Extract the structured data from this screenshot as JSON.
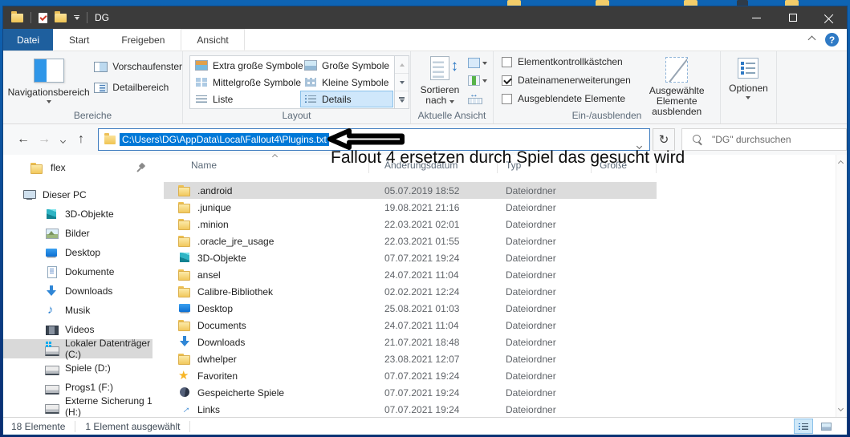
{
  "titlebar": {
    "title": "DG"
  },
  "tabs": {
    "file_label": "Datei",
    "items": [
      {
        "label": "Start",
        "active": false
      },
      {
        "label": "Freigeben",
        "active": false
      },
      {
        "label": "Ansicht",
        "active": true
      }
    ]
  },
  "ribbon": {
    "panes": {
      "label": "Bereiche",
      "nav_button": "Navigationsbereich",
      "preview_button": "Vorschaufenster",
      "details_button": "Detailbereich"
    },
    "layout": {
      "label": "Layout",
      "items": [
        {
          "label": "Extra große Symbole",
          "icon": "extra-large-icons-icon",
          "selected": false
        },
        {
          "label": "Große Symbole",
          "icon": "large-icons-icon",
          "selected": false
        },
        {
          "label": "Mittelgroße Symbole",
          "icon": "medium-icons-icon",
          "selected": false
        },
        {
          "label": "Kleine Symbole",
          "icon": "small-icons-icon",
          "selected": false
        },
        {
          "label": "Liste",
          "icon": "list-view-icon",
          "selected": false
        },
        {
          "label": "Details",
          "icon": "details-view-icon",
          "selected": true
        }
      ]
    },
    "current_view": {
      "label": "Aktuelle Ansicht",
      "sort_line1": "Sortieren",
      "sort_line2": "nach"
    },
    "show_hide": {
      "label": "Ein-/ausblenden",
      "checkboxes": [
        {
          "label": "Elementkontrollkästchen",
          "checked": false
        },
        {
          "label": "Dateinamenerweiterungen",
          "checked": true
        },
        {
          "label": "Ausgeblendete Elemente",
          "checked": false
        }
      ],
      "hide_selected_line1": "Ausgewählte",
      "hide_selected_line2": "Elemente ausblenden"
    },
    "options": {
      "button": "Optionen"
    }
  },
  "addressbar": {
    "path": "C:\\Users\\DG\\AppData\\Local\\Fallout4\\Plugins.txt",
    "search_placeholder": "\"DG\" durchsuchen"
  },
  "annotation": {
    "text": "Fallout 4 ersetzen durch Spiel das gesucht wird"
  },
  "sidebar": {
    "items": [
      {
        "label": "flex",
        "icon": "folder-icon",
        "quick": true,
        "pinned": true
      },
      {
        "label": "Dieser PC",
        "icon": "this-pc-icon",
        "root": true
      },
      {
        "label": "3D-Objekte",
        "icon": "cube-icon",
        "child": true
      },
      {
        "label": "Bilder",
        "icon": "pictures-icon",
        "child": true
      },
      {
        "label": "Desktop",
        "icon": "desktop-icon",
        "child": true
      },
      {
        "label": "Dokumente",
        "icon": "documents-icon",
        "child": true
      },
      {
        "label": "Downloads",
        "icon": "download-icon",
        "child": true
      },
      {
        "label": "Musik",
        "icon": "music-icon",
        "child": true
      },
      {
        "label": "Videos",
        "icon": "videos-icon",
        "child": true
      },
      {
        "label": "Lokaler Datenträger (C:)",
        "icon": "drive-windows-icon",
        "child": true,
        "selected": true
      },
      {
        "label": "Spiele (D:)",
        "icon": "drive-icon",
        "child": true
      },
      {
        "label": "Progs1 (F:)",
        "icon": "drive-icon",
        "child": true
      },
      {
        "label": "Externe Sicherung 1 (H:)",
        "icon": "drive-icon",
        "child": true
      }
    ]
  },
  "filelist": {
    "columns": [
      "Name",
      "Änderungsdatum",
      "Typ",
      "Größe"
    ],
    "rows": [
      {
        "name": ".android",
        "icon": "folder-icon",
        "date": "05.07.2019 18:52",
        "type": "Dateiordner",
        "size": "",
        "selected": true
      },
      {
        "name": ".junique",
        "icon": "folder-icon",
        "date": "19.08.2021 21:16",
        "type": "Dateiordner",
        "size": ""
      },
      {
        "name": ".minion",
        "icon": "folder-icon",
        "date": "22.03.2021 02:01",
        "type": "Dateiordner",
        "size": ""
      },
      {
        "name": ".oracle_jre_usage",
        "icon": "folder-icon",
        "date": "22.03.2021 01:55",
        "type": "Dateiordner",
        "size": ""
      },
      {
        "name": "3D-Objekte",
        "icon": "cube-icon",
        "date": "07.07.2021 19:24",
        "type": "Dateiordner",
        "size": ""
      },
      {
        "name": "ansel",
        "icon": "folder-icon",
        "date": "24.07.2021 11:04",
        "type": "Dateiordner",
        "size": ""
      },
      {
        "name": "Calibre-Bibliothek",
        "icon": "folder-icon",
        "date": "02.02.2021 12:24",
        "type": "Dateiordner",
        "size": ""
      },
      {
        "name": "Desktop",
        "icon": "desktop-icon",
        "date": "25.08.2021 01:03",
        "type": "Dateiordner",
        "size": ""
      },
      {
        "name": "Documents",
        "icon": "folder-icon",
        "date": "24.07.2021 11:04",
        "type": "Dateiordner",
        "size": ""
      },
      {
        "name": "Downloads",
        "icon": "download-icon",
        "date": "21.07.2021 18:48",
        "type": "Dateiordner",
        "size": ""
      },
      {
        "name": "dwhelper",
        "icon": "folder-icon",
        "date": "23.08.2021 12:07",
        "type": "Dateiordner",
        "size": ""
      },
      {
        "name": "Favoriten",
        "icon": "star-icon",
        "date": "07.07.2021 19:24",
        "type": "Dateiordner",
        "size": ""
      },
      {
        "name": "Gespeicherte Spiele",
        "icon": "saved-games-icon",
        "date": "07.07.2021 19:24",
        "type": "Dateiordner",
        "size": ""
      },
      {
        "name": "Links",
        "icon": "links-icon",
        "date": "07.07.2021 19:24",
        "type": "Dateiordner",
        "size": ""
      }
    ]
  },
  "statusbar": {
    "items_count": "18 Elemente",
    "selected_count": "1 Element ausgewählt"
  }
}
